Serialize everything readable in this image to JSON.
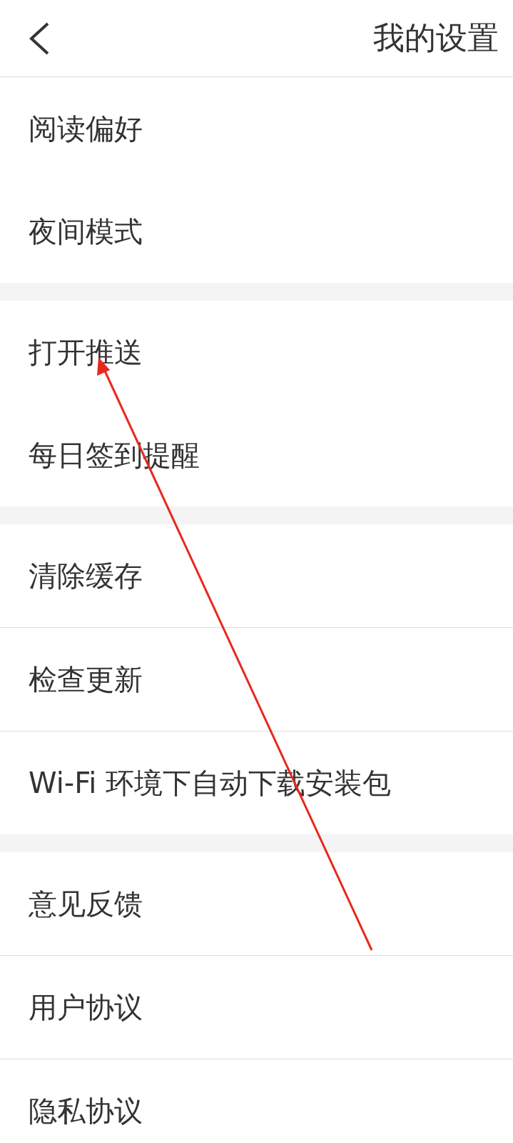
{
  "header": {
    "title": "我的设置"
  },
  "sections": [
    {
      "dividers": false,
      "items": [
        {
          "label": "阅读偏好"
        },
        {
          "label": "夜间模式"
        }
      ]
    },
    {
      "dividers": false,
      "items": [
        {
          "label": "打开推送"
        },
        {
          "label": "每日签到提醒"
        }
      ]
    },
    {
      "dividers": true,
      "items": [
        {
          "label": "清除缓存"
        },
        {
          "label": "检查更新"
        },
        {
          "label": "Wi-Fi 环境下自动下载安装包"
        }
      ]
    },
    {
      "dividers": true,
      "items": [
        {
          "label": "意见反馈"
        },
        {
          "label": "用户协议"
        },
        {
          "label": "隐私协议"
        }
      ]
    }
  ],
  "annotation": {
    "kind": "arrow"
  }
}
